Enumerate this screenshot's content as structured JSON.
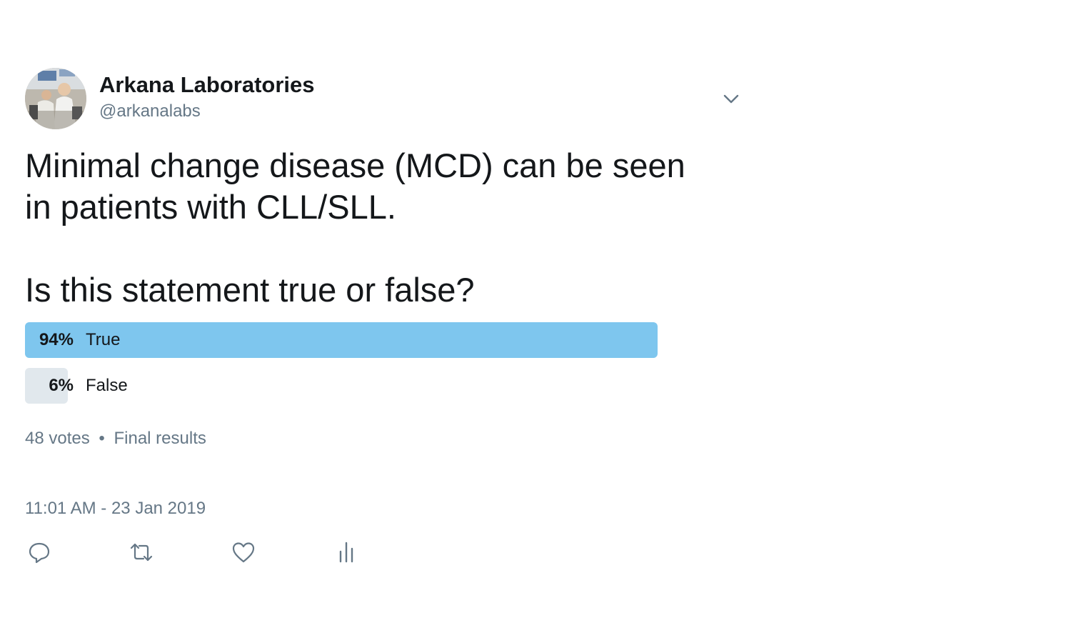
{
  "author": {
    "name": "Arkana Laboratories",
    "handle": "@arkanalabs"
  },
  "icons": {
    "avatar": "avatar-photo",
    "caret": "chevron-down-icon",
    "reply": "reply-icon",
    "retweet": "retweet-icon",
    "like": "heart-icon",
    "analytics": "analytics-icon"
  },
  "tweet": {
    "text_line1": "Minimal change disease (MCD) can be seen",
    "text_line2": "in patients with CLL/SLL.",
    "question": "Is this statement true or false?"
  },
  "poll": {
    "choices": [
      {
        "percent_label": "94%",
        "label": "True",
        "percent": 94,
        "winner": true
      },
      {
        "percent_label": "6%",
        "label": "False",
        "percent": 6,
        "winner": false
      }
    ],
    "votes": "48 votes",
    "separator": "•",
    "status": "Final results"
  },
  "timestamp": "11:01 AM - 23 Jan 2019",
  "colors": {
    "winner_fill": "#7ec6ee",
    "loser_fill": "#e1e8ed",
    "text_primary": "#14171a",
    "text_secondary": "#657786",
    "icon_gray": "#657786"
  }
}
